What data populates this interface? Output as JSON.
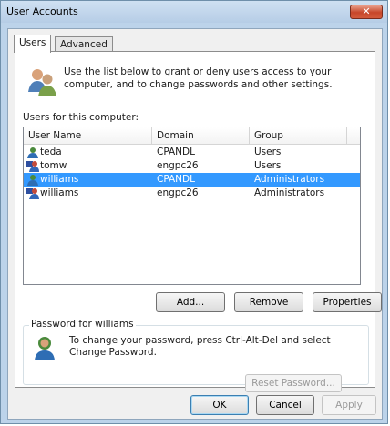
{
  "window": {
    "title": "User Accounts",
    "close_glyph": "✕"
  },
  "tabs": [
    {
      "label": "Users",
      "active": true
    },
    {
      "label": "Advanced",
      "active": false
    }
  ],
  "intro": {
    "text": "Use the list below to grant or deny users access to your computer, and to change passwords and other settings.",
    "icon": "users-group-icon"
  },
  "users_label": "Users for this computer:",
  "users_list": {
    "columns": [
      "User Name",
      "Domain",
      "Group"
    ],
    "rows": [
      {
        "name": "teda",
        "domain": "CPANDL",
        "group": "Users",
        "icon": "domain-user-icon",
        "selected": false
      },
      {
        "name": "tomw",
        "domain": "engpc26",
        "group": "Users",
        "icon": "local-user-icon",
        "selected": false
      },
      {
        "name": "williams",
        "domain": "CPANDL",
        "group": "Administrators",
        "icon": "domain-user-icon",
        "selected": true
      },
      {
        "name": "williams",
        "domain": "engpc26",
        "group": "Administrators",
        "icon": "local-user-icon",
        "selected": false
      }
    ]
  },
  "list_buttons": {
    "add": "Add...",
    "remove": "Remove",
    "properties": "Properties"
  },
  "password_group": {
    "title": "Password for williams",
    "text": "To change your password, press Ctrl-Alt-Del and select Change Password.",
    "icon": "user-password-icon",
    "reset_label": "Reset Password..."
  },
  "dialog_buttons": {
    "ok": "OK",
    "cancel": "Cancel",
    "apply": "Apply"
  },
  "colors": {
    "selection": "#3399ff",
    "title_bg": "#bcd3ea",
    "close": "#c7462a"
  }
}
